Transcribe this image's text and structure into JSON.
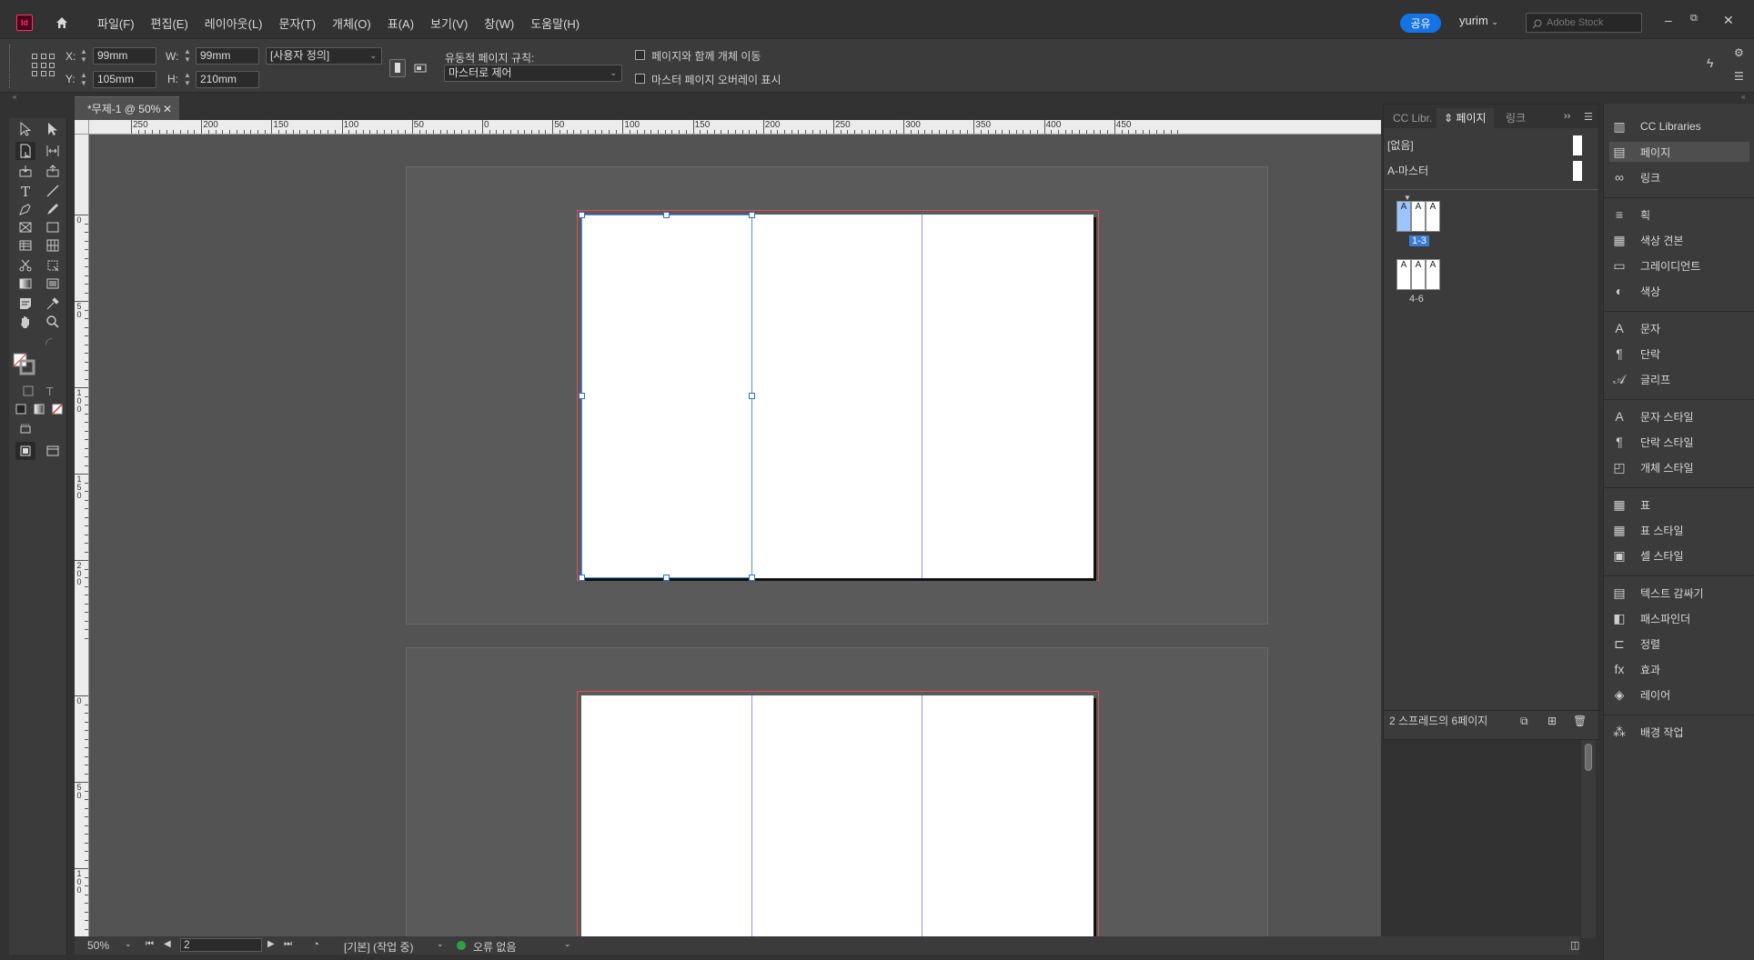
{
  "app": {
    "logo_text": "Id",
    "menus": [
      "파일(F)",
      "편집(E)",
      "레이아웃(L)",
      "문자(T)",
      "개체(O)",
      "표(A)",
      "보기(V)",
      "창(W)",
      "도움말(H)"
    ],
    "share_label": "공유",
    "user_name": "yurim",
    "search_placeholder": "Adobe Stock"
  },
  "control_bar": {
    "x_label": "X:",
    "x_value": "99mm",
    "y_label": "Y:",
    "y_value": "105mm",
    "w_label": "W:",
    "w_value": "99mm",
    "h_label": "H:",
    "h_value": "210mm",
    "preset_value": "[사용자 정의]",
    "liquid_rule_label": "유동적 페이지 규칙:",
    "liquid_rule_value": "마스터로 제어",
    "move_objects_label": "페이지와 함께 개체 이동",
    "master_overlay_label": "마스터 페이지 오버레이 표시"
  },
  "document": {
    "tab_title": "*무제-1 @ 50%"
  },
  "rulers": {
    "h_labels": [
      "250",
      "200",
      "150",
      "100",
      "50",
      "0",
      "50",
      "100",
      "150",
      "200",
      "250",
      "300",
      "350",
      "400",
      "450"
    ],
    "v_labels_spread1": [
      "0",
      "50",
      "100",
      "150",
      "200"
    ],
    "v_labels_spread2": [
      "0",
      "50",
      "100"
    ]
  },
  "pages_panel": {
    "tabs": [
      "CC Libr.",
      "페이지",
      "링크"
    ],
    "none_label": "[없음]",
    "master_label": "A-마스터",
    "spreads": [
      {
        "label": "1-3",
        "pages": [
          "A",
          "A",
          "A"
        ],
        "selected": true
      },
      {
        "label": "4-6",
        "pages": [
          "A",
          "A",
          "A"
        ],
        "selected": false
      }
    ],
    "footer_text": "2 스프레드의 6페이지"
  },
  "dock": {
    "groups": [
      [
        {
          "label": "CC Libraries",
          "icon": "cc-libraries-icon"
        },
        {
          "label": "페이지",
          "icon": "pages-icon"
        },
        {
          "label": "링크",
          "icon": "links-icon"
        }
      ],
      [
        {
          "label": "획",
          "icon": "stroke-icon"
        },
        {
          "label": "색상 견본",
          "icon": "swatches-icon"
        },
        {
          "label": "그레이디언트",
          "icon": "gradient-icon"
        },
        {
          "label": "색상",
          "icon": "color-icon"
        }
      ],
      [
        {
          "label": "문자",
          "icon": "character-icon"
        },
        {
          "label": "단락",
          "icon": "paragraph-icon"
        },
        {
          "label": "글리프",
          "icon": "glyphs-icon"
        }
      ],
      [
        {
          "label": "문자 스타일",
          "icon": "character-style-icon"
        },
        {
          "label": "단락 스타일",
          "icon": "paragraph-style-icon"
        },
        {
          "label": "개체 스타일",
          "icon": "object-style-icon"
        }
      ],
      [
        {
          "label": "표",
          "icon": "table-icon"
        },
        {
          "label": "표 스타일",
          "icon": "table-style-icon"
        },
        {
          "label": "셀 스타일",
          "icon": "cell-style-icon"
        }
      ],
      [
        {
          "label": "텍스트 감싸기",
          "icon": "text-wrap-icon"
        },
        {
          "label": "패스파인더",
          "icon": "pathfinder-icon"
        },
        {
          "label": "정렬",
          "icon": "align-icon"
        },
        {
          "label": "효과",
          "icon": "effects-icon"
        },
        {
          "label": "레이어",
          "icon": "layers-icon"
        }
      ],
      [
        {
          "label": "배경 작업",
          "icon": "background-tasks-icon"
        }
      ]
    ]
  },
  "status_bar": {
    "zoom": "50%",
    "page_number": "2",
    "preflight_profile": "[기본] (작업 중)",
    "error_status": "오류 없음"
  }
}
